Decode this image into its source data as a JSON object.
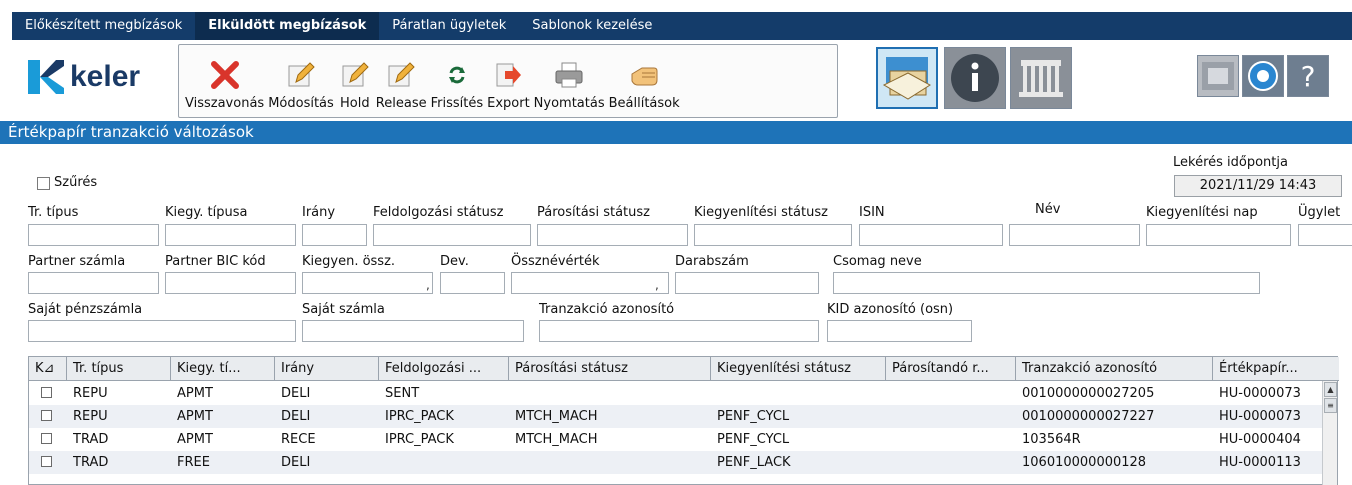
{
  "tabs": [
    {
      "label": "Előkészített megbízások",
      "active": false
    },
    {
      "label": "Elküldött megbízások",
      "active": true
    },
    {
      "label": "Páratlan ügyletek",
      "active": false
    },
    {
      "label": "Sablonok kezelése",
      "active": false
    }
  ],
  "logo": {
    "text": "keler"
  },
  "toolbar": {
    "buttons": [
      {
        "label": "Visszavonás",
        "icon": "delete-x-icon"
      },
      {
        "label": "Módosítás",
        "icon": "edit-pencil-icon"
      },
      {
        "label": "Hold",
        "icon": "edit-pencil-icon"
      },
      {
        "label": "Release",
        "icon": "edit-pencil-icon"
      },
      {
        "label": "Frissítés",
        "icon": "refresh-icon"
      },
      {
        "label": "Export",
        "icon": "export-icon"
      },
      {
        "label": "Nyomtatás",
        "icon": "printer-icon"
      },
      {
        "label": "Beállítások",
        "icon": "hand-icon"
      }
    ]
  },
  "section": {
    "title": "Értékpapír tranzakció változások"
  },
  "filters": {
    "filter_checkbox_label": "Szűrés",
    "timestamp_label": "Lekérés időpontja",
    "timestamp_value": "2021/11/29 14:43",
    "row1": [
      "Tr. típus",
      "Kiegy. típusa",
      "Irány",
      "Feldolgozási státusz",
      "Párosítási státusz",
      "Kiegyenlítési státusz",
      "ISIN",
      "Név",
      "Kiegyenlítési nap",
      "Ügylet"
    ],
    "row2": [
      "Partner számla",
      "Partner BIC kód",
      "Kiegyen. össz.",
      "Dev.",
      "Össznévérték",
      "Darabszám",
      "Csomag neve"
    ],
    "row3": [
      "Saját pénzszámla",
      "Saját számla",
      "Tranzakció azonosító",
      "KID azonosító (osn)"
    ]
  },
  "grid": {
    "columns": [
      "K⊿",
      "Tr. típus",
      "Kiegy. tí...",
      "Irány",
      "Feldolgozási ...",
      "Párosítási státusz",
      "Kiegyenlítési státusz",
      "Párosítandó r...",
      "Tranzakció azonosító",
      "Értékpapír..."
    ],
    "rows": [
      [
        "REPU",
        "APMT",
        "DELI",
        "SENT",
        "",
        "",
        "",
        "0010000000027205",
        "HU-0000073"
      ],
      [
        "REPU",
        "APMT",
        "DELI",
        "IPRC_PACK",
        "MTCH_MACH",
        "PENF_CYCL",
        "",
        "0010000000027227",
        "HU-0000073"
      ],
      [
        "TRAD",
        "APMT",
        "RECE",
        "IPRC_PACK",
        "MTCH_MACH",
        "PENF_CYCL",
        "",
        "103564R",
        "HU-0000404"
      ],
      [
        "TRAD",
        "FREE",
        "DELI",
        "",
        "",
        "PENF_LACK",
        "",
        "106010000000128",
        "HU-0000113"
      ]
    ]
  },
  "colors": {
    "tabbar": "#143c6a",
    "section": "#1e73b8",
    "alt_row": "#edf0f5"
  }
}
